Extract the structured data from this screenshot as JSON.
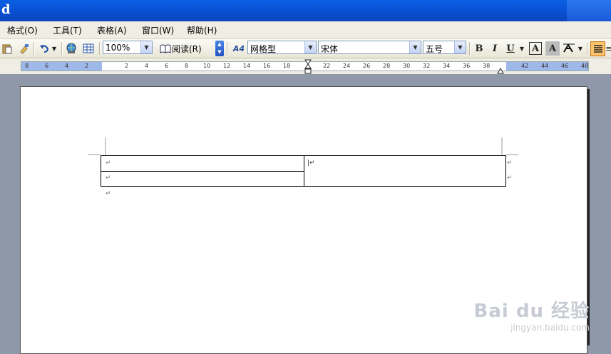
{
  "window": {
    "title": "d"
  },
  "menu": [
    "格式(O)",
    "工具(T)",
    "表格(A)",
    "窗口(W)",
    "帮助(H)"
  ],
  "toolbar": {
    "zoom": "100%",
    "read_label": "阅读(R)",
    "style": "网格型",
    "font": "宋体",
    "size": "五号",
    "bold": "B",
    "italic": "I",
    "underline": "U",
    "font_color": "A",
    "shade": "A",
    "style_glyph": "A4"
  },
  "ruler": {
    "left": [
      "8",
      "6",
      "4",
      "2"
    ],
    "right": [
      "2",
      "4",
      "6",
      "8",
      "10",
      "12",
      "14",
      "16",
      "18",
      "22",
      "24",
      "26",
      "28",
      "30",
      "32",
      "34",
      "36",
      "38",
      "42",
      "44",
      "46",
      "48"
    ]
  },
  "document": {
    "para_mark": "↵",
    "cursor_mark": "|↵"
  },
  "watermark": {
    "brand": "Bai du 经验",
    "url": "jingyan.baidu.com"
  }
}
